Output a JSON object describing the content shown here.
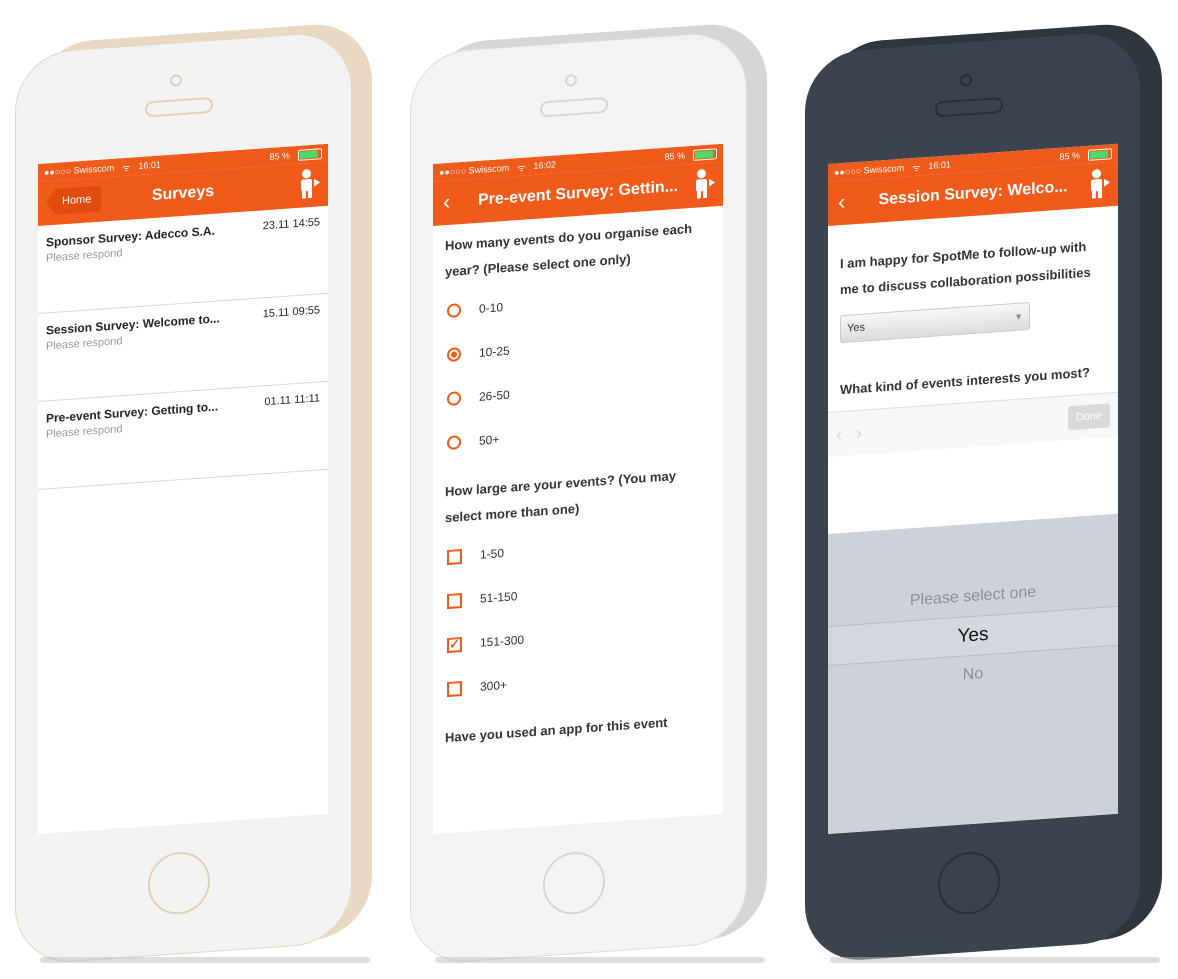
{
  "status": {
    "carrier": "●●○○○ Swisscom",
    "wifi": "ᯤ",
    "battery": "85 %"
  },
  "phone1": {
    "time": "16:01",
    "title": "Surveys",
    "back": "Home",
    "surveys": [
      {
        "title": "Sponsor Survey: Adecco S.A.",
        "date": "23.11 14:55",
        "status": "Please respond"
      },
      {
        "title": "Session Survey: Welcome to...",
        "date": "15.11 09:55",
        "status": "Please respond"
      },
      {
        "title": "Pre-event Survey: Getting to...",
        "date": "01.11 11:11",
        "status": "Please respond"
      }
    ]
  },
  "phone2": {
    "time": "16:02",
    "title": "Pre-event Survey: Gettin...",
    "q1": "How many events do you organise each year? (Please select one only)",
    "q1_options": [
      "0-10",
      "10-25",
      "26-50",
      "50+"
    ],
    "q1_selected": 1,
    "q2": "How large are your events? (You may select more than one)",
    "q2_options": [
      "1-50",
      "51-150",
      "151-300",
      "300+"
    ],
    "q2_checked": [
      false,
      false,
      true,
      false
    ],
    "q3": "Have you used an app for this event"
  },
  "phone3": {
    "time": "16:01",
    "title": "Session Survey: Welco...",
    "q1": "I am happy for SpotMe to follow-up with me to discuss collaboration possibilities",
    "select_value": "Yes",
    "q2": "What kind of events interests you most?",
    "done": "Done",
    "picker": [
      "Please select one",
      "Yes",
      "No"
    ],
    "picker_selected": 1
  },
  "colors": {
    "accent": "#f05a1a",
    "cream_body": "#ead9c2",
    "silver_body": "#d6d6d6",
    "dark_body": "#3b434e"
  }
}
